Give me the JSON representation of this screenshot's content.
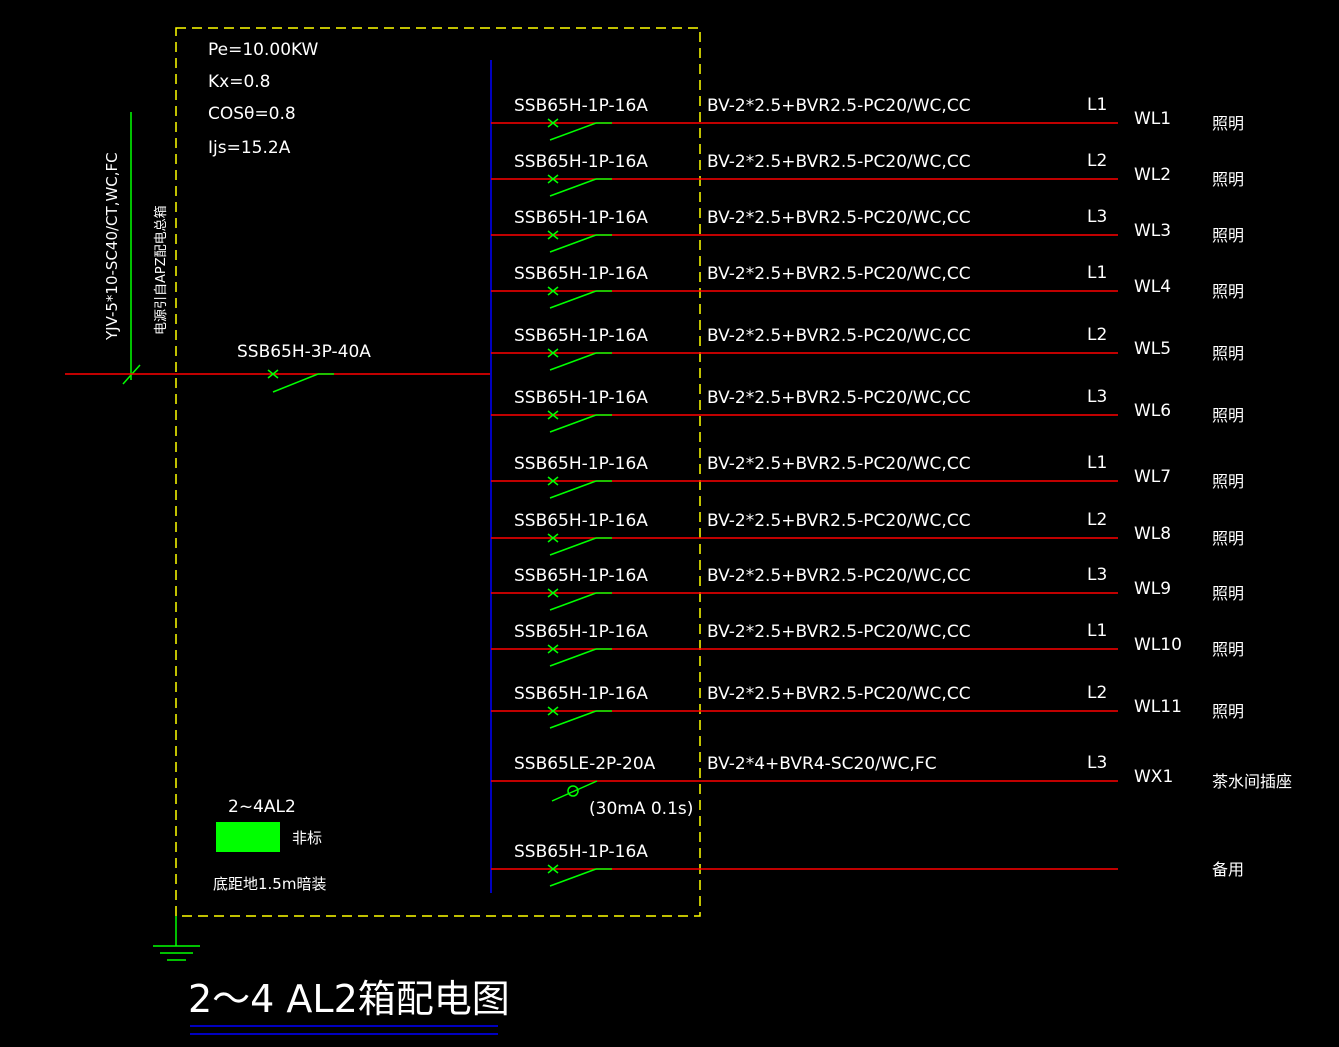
{
  "colors": {
    "background": "#000000",
    "text": "#ffffff",
    "circuit_line": "#ff0000",
    "breaker": "#00ff00",
    "busbar": "#0000ff",
    "box_outline": "#ffff00",
    "title_underline": "#0000ff"
  },
  "params": {
    "pe": "Pe=10.00KW",
    "kx": "Kx=0.8",
    "cos": "COSθ=0.8",
    "ijs": "Ijs=15.2A"
  },
  "incoming": {
    "cable": "YJV-5*10-SC40/CT,WC,FC",
    "source": "电源引自APZ配电总箱",
    "main_breaker": "SSB65H-3P-40A"
  },
  "circuits": [
    {
      "breaker": "SSB65H-1P-16A",
      "cable": "BV-2*2.5+BVR2.5-PC20/WC,CC",
      "phase": "L1",
      "id": "WL1",
      "load": "照明"
    },
    {
      "breaker": "SSB65H-1P-16A",
      "cable": "BV-2*2.5+BVR2.5-PC20/WC,CC",
      "phase": "L2",
      "id": "WL2",
      "load": "照明"
    },
    {
      "breaker": "SSB65H-1P-16A",
      "cable": "BV-2*2.5+BVR2.5-PC20/WC,CC",
      "phase": "L3",
      "id": "WL3",
      "load": "照明"
    },
    {
      "breaker": "SSB65H-1P-16A",
      "cable": "BV-2*2.5+BVR2.5-PC20/WC,CC",
      "phase": "L1",
      "id": "WL4",
      "load": "照明"
    },
    {
      "breaker": "SSB65H-1P-16A",
      "cable": "BV-2*2.5+BVR2.5-PC20/WC,CC",
      "phase": "L2",
      "id": "WL5",
      "load": "照明"
    },
    {
      "breaker": "SSB65H-1P-16A",
      "cable": "BV-2*2.5+BVR2.5-PC20/WC,CC",
      "phase": "L3",
      "id": "WL6",
      "load": "照明"
    },
    {
      "breaker": "SSB65H-1P-16A",
      "cable": "BV-2*2.5+BVR2.5-PC20/WC,CC",
      "phase": "L1",
      "id": "WL7",
      "load": "照明"
    },
    {
      "breaker": "SSB65H-1P-16A",
      "cable": "BV-2*2.5+BVR2.5-PC20/WC,CC",
      "phase": "L2",
      "id": "WL8",
      "load": "照明"
    },
    {
      "breaker": "SSB65H-1P-16A",
      "cable": "BV-2*2.5+BVR2.5-PC20/WC,CC",
      "phase": "L3",
      "id": "WL9",
      "load": "照明"
    },
    {
      "breaker": "SSB65H-1P-16A",
      "cable": "BV-2*2.5+BVR2.5-PC20/WC,CC",
      "phase": "L1",
      "id": "WL10",
      "load": "照明"
    },
    {
      "breaker": "SSB65H-1P-16A",
      "cable": "BV-2*2.5+BVR2.5-PC20/WC,CC",
      "phase": "L2",
      "id": "WL11",
      "load": "照明"
    },
    {
      "breaker": "SSB65LE-2P-20A",
      "cable": "BV-2*4+BVR4-SC20/WC,FC",
      "phase": "L3",
      "id": "WX1",
      "load": "茶水间插座",
      "note": "(30mA 0.1s)"
    },
    {
      "breaker": "SSB65H-1P-16A",
      "cable": "",
      "phase": "",
      "id": "",
      "load": "备用"
    }
  ],
  "legend": {
    "label": "2~4AL2",
    "type": "非标",
    "mount": "底距地1.5m暗装"
  },
  "title": "2～4 AL2箱配电图"
}
